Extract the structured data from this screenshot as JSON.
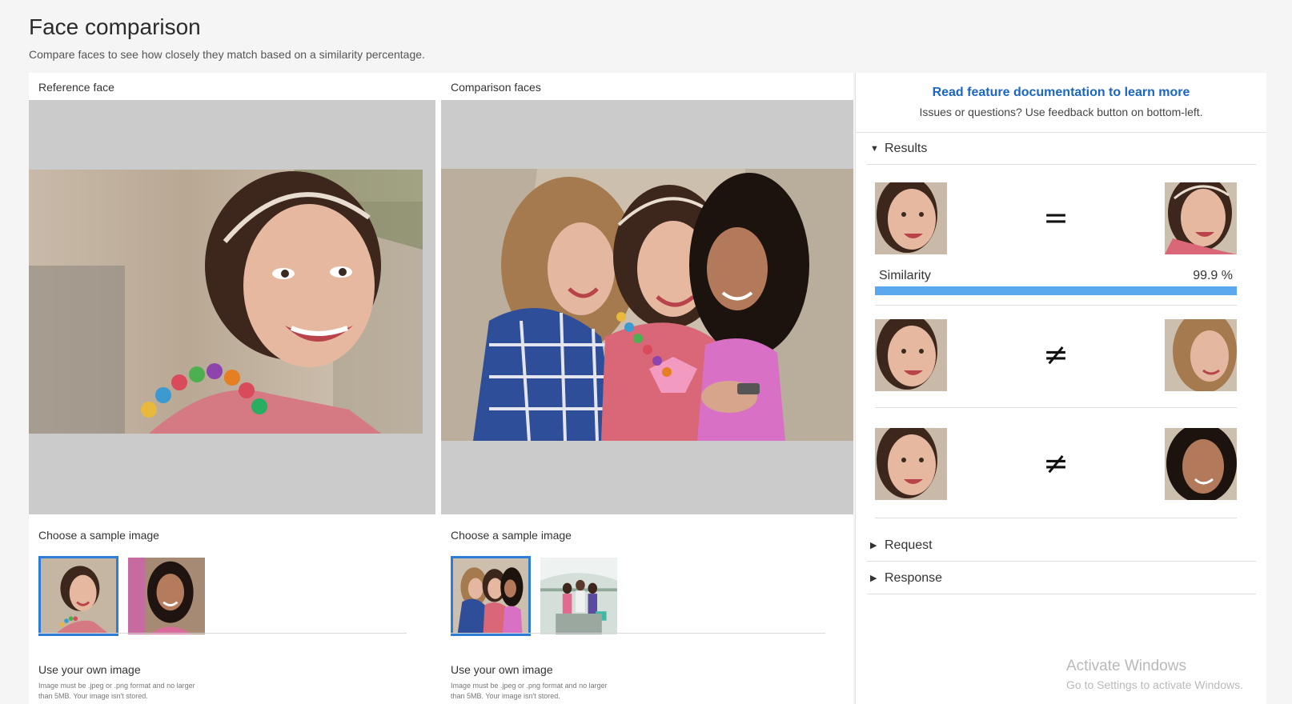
{
  "header": {
    "title": "Face comparison",
    "subtitle": "Compare faces to see how closely they match based on a similarity percentage."
  },
  "reference": {
    "label": "Reference face",
    "sample_label": "Choose a sample image",
    "own_label": "Use your own image",
    "own_note": "Image must be .jpeg or .png format and no larger than 5MB. Your image isn't stored."
  },
  "comparison": {
    "label": "Comparison faces",
    "sample_label": "Choose a sample image",
    "own_label": "Use your own image",
    "own_note": "Image must be .jpeg or .png format and no larger than 5MB. Your image isn't stored."
  },
  "side_panel": {
    "doc_link": "Read feature documentation to learn more",
    "doc_sub": "Issues or questions? Use feedback button on bottom-left.",
    "sections": {
      "results": "Results",
      "request": "Request",
      "response": "Response"
    },
    "results": [
      {
        "symbol": "=",
        "similarity_label": "Similarity",
        "similarity_value": "99.9 %",
        "similarity_fraction": 0.999
      },
      {
        "symbol": "≠"
      },
      {
        "symbol": "≠"
      }
    ]
  },
  "watermark": {
    "line1": "Activate Windows",
    "line2": "Go to Settings to activate Windows."
  },
  "colors": {
    "accent": "#2d7cd6",
    "link": "#1a66c2",
    "similarity_bar": "#5aa8ee",
    "placeholder_gray": "#cbcbcb"
  },
  "icons": {
    "expanded_caret": "caret-down-icon",
    "collapsed_caret": "caret-right-icon"
  }
}
